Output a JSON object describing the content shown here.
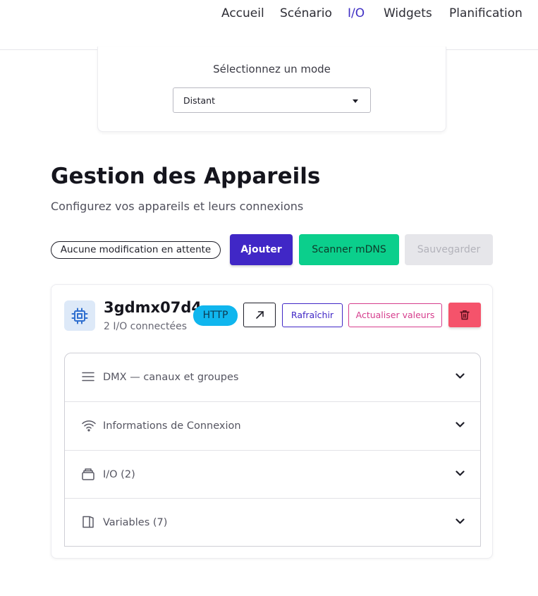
{
  "nav": {
    "items": [
      {
        "label": "Accueil"
      },
      {
        "label": "Scénario"
      },
      {
        "label": "I/O",
        "active": true
      },
      {
        "label": "Widgets"
      },
      {
        "label": "Planification"
      }
    ]
  },
  "mode": {
    "label": "Sélectionnez un mode",
    "selected": "Distant"
  },
  "page": {
    "title": "Gestion des Appareils",
    "subtitle": "Configurez vos appareils et leurs connexions"
  },
  "toolbar": {
    "status": "Aucune modification en attente",
    "add_label": "Ajouter",
    "scan_label": "Scanner mDNS",
    "save_label": "Sauvegarder"
  },
  "device": {
    "icon": "chip-icon",
    "name": "3gdmx07d4",
    "subtitle": "2 I/O connectées",
    "protocol": "HTTP",
    "refresh_label": "Rafraîchir",
    "update_label": "Actualiser valeurs",
    "sections": [
      {
        "icon": "menu-lines-icon",
        "label": "DMX — canaux et groupes"
      },
      {
        "icon": "wifi-icon",
        "label": "Informations de Connexion"
      },
      {
        "icon": "stack-icon",
        "label": "I/O (2)"
      },
      {
        "icon": "variables-icon",
        "label": "Variables (7)"
      }
    ]
  },
  "colors": {
    "accent": "#4027c6",
    "scan": "#0bcf8c",
    "http_badge": "#10b6ee",
    "delete": "#f5536b",
    "update": "#d63d8d"
  }
}
